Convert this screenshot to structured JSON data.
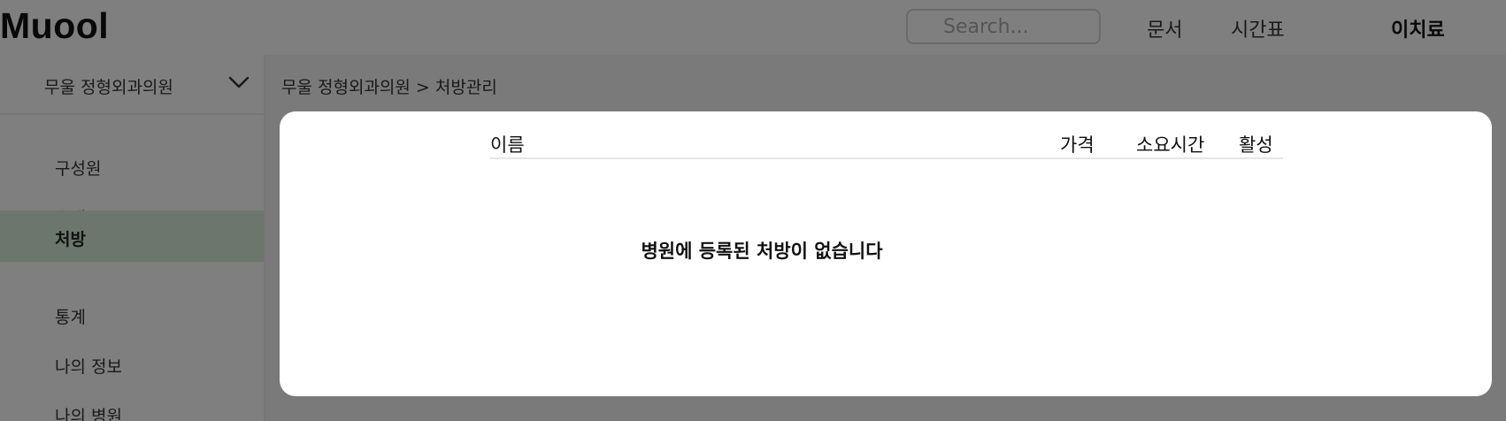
{
  "header": {
    "logo": "Muool",
    "search_placeholder": "Search...",
    "nav": {
      "docs": "문서",
      "schedule": "시간표",
      "user": "이치료"
    }
  },
  "sidebar": {
    "hospital": "무울 정형외과의원",
    "items": [
      {
        "label": "구성원"
      },
      {
        "label": "초대"
      },
      {
        "label": "처방"
      },
      {
        "label": "통계"
      },
      {
        "label": "나의 정보"
      },
      {
        "label": "나의 병원"
      }
    ],
    "active_item": "처방"
  },
  "main": {
    "breadcrumb": "무울 정형외과의원 > 처방관리",
    "table": {
      "columns": [
        "이름",
        "가격",
        "소요시간",
        "활성"
      ]
    },
    "empty_message": "병원에 등록된 처방이 없습니다"
  },
  "colors": {
    "active_item_bg": "#d9ecd9",
    "overlay": "rgba(0,0,0,0.5)"
  }
}
